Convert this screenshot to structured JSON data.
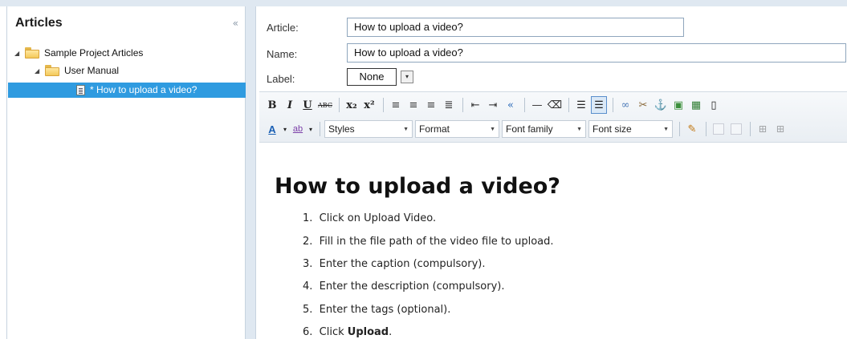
{
  "sidebar": {
    "title": "Articles",
    "collapse_icon": "«",
    "tree": [
      {
        "label": "Sample Project Articles",
        "type": "folder"
      },
      {
        "label": "User Manual",
        "type": "folder"
      },
      {
        "label": "* How to upload a video?",
        "type": "document",
        "selected": true
      }
    ]
  },
  "form": {
    "article_label": "Article:",
    "article_value": "How to upload a video?",
    "name_label": "Name:",
    "name_value": "How to upload a video?",
    "label_label": "Label:",
    "label_value": "None"
  },
  "toolbar": {
    "row1": [
      "B",
      "I",
      "U",
      "ABC",
      "x₂",
      "x²",
      "align-left",
      "align-center",
      "align-right",
      "justify",
      "outdent",
      "indent",
      "blockquote",
      "hr",
      "eraser",
      "bullet-list",
      "numbered-list",
      "link",
      "unlink",
      "anchor",
      "image",
      "media",
      "page"
    ],
    "styles": "Styles",
    "format": "Format",
    "font_family": "Font family",
    "font_size": "Font size"
  },
  "content": {
    "heading": "How to upload a video?",
    "steps": [
      {
        "num": "1.",
        "text": "Click on Upload Video."
      },
      {
        "num": "2.",
        "text": "Fill in the file path of the video file to upload."
      },
      {
        "num": "3.",
        "text": "Enter the caption (compulsory)."
      },
      {
        "num": "4.",
        "text": "Enter the description (compulsory)."
      },
      {
        "num": "5.",
        "text": "Enter the tags (optional)."
      },
      {
        "num": "6.",
        "text": "Click ",
        "bold": "Upload",
        "after": "."
      }
    ]
  },
  "colors": {
    "selection": "#2f9be0",
    "panel_border": "#c7d3df",
    "strip": "#dfe8f1"
  }
}
